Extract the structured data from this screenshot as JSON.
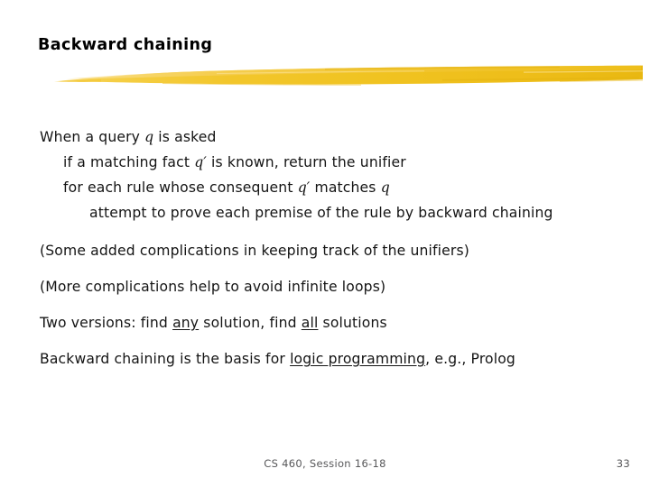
{
  "slide": {
    "title": "Backward chaining",
    "divider": {
      "icon": "brush-stroke-divider",
      "color": "#F0C321",
      "color_light": "#F7D457",
      "color_dark": "#E3B415"
    },
    "body": {
      "line1": {
        "pre": "When a query ",
        "var": "q",
        "post": " is asked"
      },
      "line2": {
        "pre": "if a matching fact ",
        "var": "q",
        "prime": "′",
        "post": " is known, return the unifier"
      },
      "line3": {
        "pre": "for each rule whose consequent ",
        "var": "q",
        "prime": "′",
        "mid": " matches ",
        "var2": "q",
        "post": ""
      },
      "line4": {
        "text": "attempt to prove each premise of the rule by backward chaining"
      },
      "line5": {
        "text": "(Some added complications in keeping track of the unifiers)"
      },
      "line6": {
        "text": "(More complications help to avoid infinite loops)"
      },
      "line7": {
        "pre": "Two versions: find ",
        "u1": "any",
        "mid": " solution, find ",
        "u2": "all",
        "post": " solutions"
      },
      "line8": {
        "pre": "Backward chaining is the basis for ",
        "u1": "logic programming",
        "post": ", e.g., Prolog"
      }
    },
    "footer": {
      "center": "CS 460, Session 16-18",
      "page": "33"
    }
  }
}
